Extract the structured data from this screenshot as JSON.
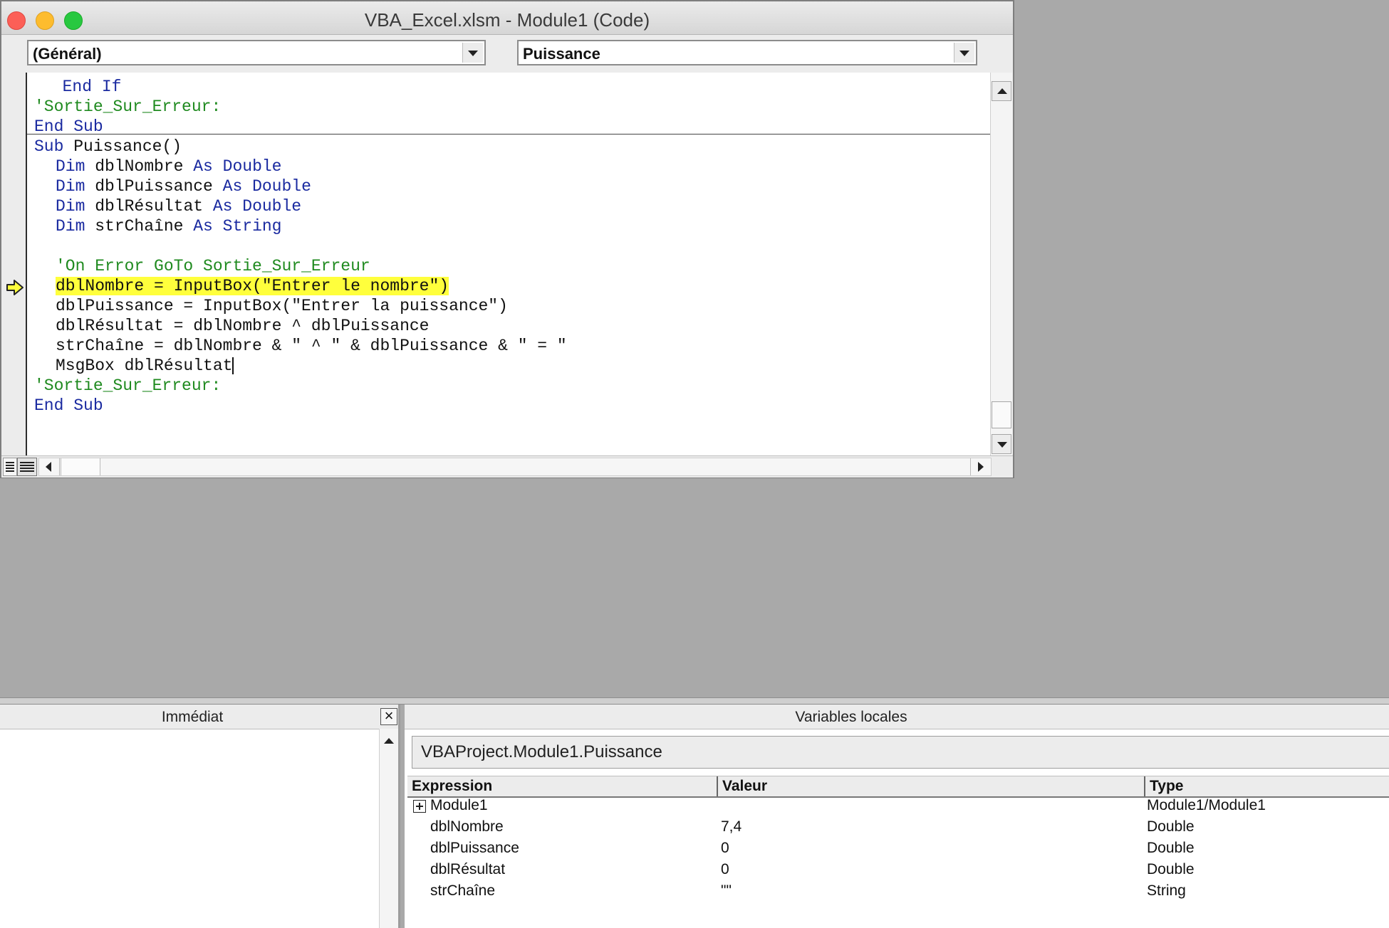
{
  "window": {
    "title": "VBA_Excel.xlsm - Module1 (Code)"
  },
  "object_combo": {
    "value": "(Général)"
  },
  "procedure_combo": {
    "value": "Puissance"
  },
  "code": {
    "l1": [
      "  ",
      "End If",
      ""
    ],
    "l2": "'Sortie_Sur_Erreur:",
    "l3": "End Sub",
    "l4_kw": "Sub",
    "l4_rest": " Puissance()",
    "dims": [
      {
        "dim": "Dim",
        "var": " dblNombre ",
        "as": "As",
        "type": " Double"
      },
      {
        "dim": "Dim",
        "var": " dblPuissance ",
        "as": "As",
        "type": " Double"
      },
      {
        "dim": "Dim",
        "var": " dblRésultat ",
        "as": "As",
        "type": " Double"
      },
      {
        "dim": "Dim",
        "var": " strChaîne ",
        "as": "As",
        "type": " String"
      }
    ],
    "on_error": "'On Error GoTo Sortie_Sur_Erreur",
    "current_line": "dblNombre = InputBox(\"Entrer le nombre\")",
    "line_puissance": "dblPuissance = InputBox(\"Entrer la puissance\")",
    "line_resultat": "dblRésultat = dblNombre ^ dblPuissance",
    "line_chaine": "strChaîne = dblNombre & \" ^ \" & dblPuissance & \" = \"",
    "line_msgbox": "MsgBox dblRésultat",
    "label2": "'Sortie_Sur_Erreur:",
    "end_sub2": "End Sub"
  },
  "immediate": {
    "title": "Immédiat",
    "close_glyph": "×"
  },
  "locals": {
    "title": "Variables locales",
    "context": "VBAProject.Module1.Puissance",
    "columns": {
      "expression": "Expression",
      "value": "Valeur",
      "type": "Type"
    },
    "rows": [
      {
        "expression": "Module1",
        "value": "",
        "type": "Module1/Module1"
      },
      {
        "expression": "dblNombre",
        "value": "7,4",
        "type": "Double"
      },
      {
        "expression": "dblPuissance",
        "value": "0",
        "type": "Double"
      },
      {
        "expression": "dblRésultat",
        "value": "0",
        "type": "Double"
      },
      {
        "expression": "strChaîne",
        "value": "\"\"",
        "type": "String"
      }
    ]
  },
  "colors": {
    "keyword": "#1a2aa0",
    "comment": "#1f8a1f",
    "highlight": "#ffff3c",
    "background": "#a9a9a9"
  },
  "icons": [
    "execution-arrow-icon",
    "dropdown-arrow-icon",
    "scroll-up-icon",
    "scroll-down-icon",
    "expand-plus-icon",
    "close-icon"
  ]
}
